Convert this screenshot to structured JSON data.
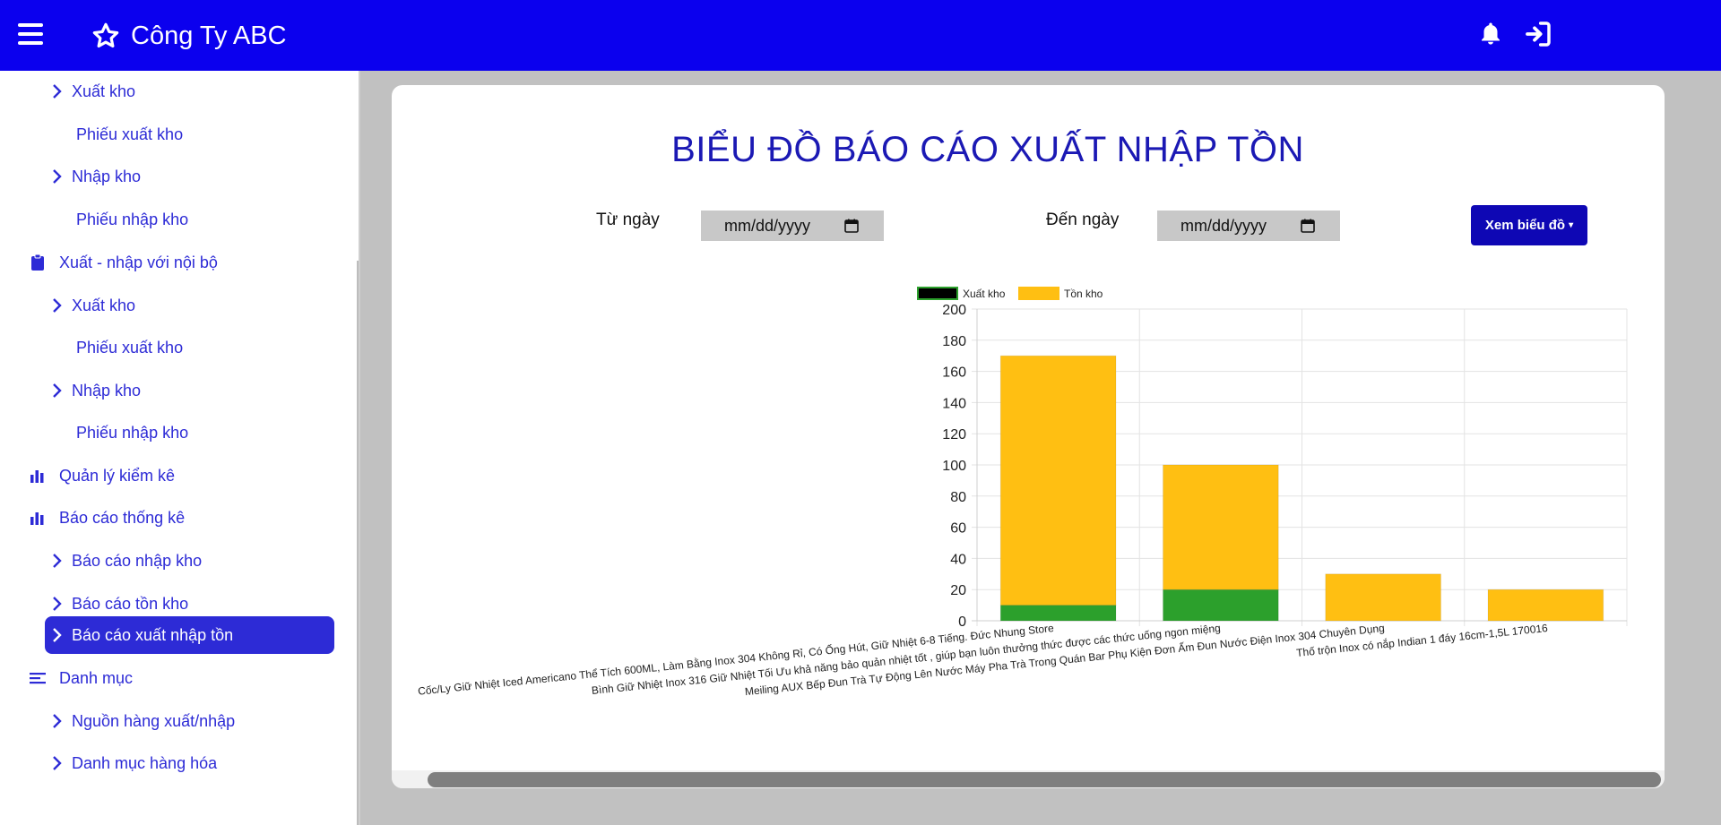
{
  "app": {
    "brand_name": "Công Ty ABC"
  },
  "sidebar": {
    "items": [
      {
        "label": "Xuất kho"
      },
      {
        "label": "Phiếu xuất kho"
      },
      {
        "label": "Nhập kho"
      },
      {
        "label": "Phiếu nhập kho"
      },
      {
        "label": "Xuất - nhập với nội bộ"
      },
      {
        "label": "Xuất kho"
      },
      {
        "label": "Phiếu xuất kho"
      },
      {
        "label": "Nhập kho"
      },
      {
        "label": "Phiếu nhập kho"
      },
      {
        "label": "Quản lý kiểm kê"
      },
      {
        "label": "Báo cáo thống kê"
      },
      {
        "label": "Báo cáo nhập kho"
      },
      {
        "label": "Báo cáo tồn kho"
      },
      {
        "label": "Báo cáo xuất nhập tồn"
      },
      {
        "label": "Danh mục"
      },
      {
        "label": "Nguồn hàng xuất/nhập"
      },
      {
        "label": "Danh mục hàng hóa"
      }
    ]
  },
  "main": {
    "title": "BIỂU ĐỒ BÁO CÁO XUẤT NHẬP TỒN",
    "from_label": "Từ ngày",
    "to_label": "Đến ngày",
    "from_value": "mm/dd/yyyy",
    "to_value": "mm/dd/yyyy",
    "view_button": "Xem biểu đồ"
  },
  "colors": {
    "topbar": "#0b00ee",
    "accent": "#2d2bd6",
    "xuat_kho": "#2ca02c",
    "ton_kho": "#ffbf12"
  },
  "chart_data": {
    "type": "bar",
    "stacked": true,
    "categories": [
      "Cốc/Ly Giữ Nhiệt Iced Americano Thể Tích 600ML, Làm Bằng Inox 304 Không Rỉ, Có Ống Hút, Giữ Nhiệt 6-8 Tiếng. Đức Nhung Store",
      "Bình Giữ Nhiệt Inox 316 Giữ Nhiệt Tối Ưu khả năng bảo quản nhiệt tốt , giúp bạn luôn thưởng thức được các thức uống ngon miệng",
      "Meiling AUX Bếp Đun Trà Tự Động Lên Nước Máy Pha Trà Trong Quán Bar Phụ Kiện Đơn Ấm Đun Nước Điện Inox 304 Chuyên Dụng",
      "Thố trộn Inox có nắp Indian 1 đáy 16cm-1,5L 170016"
    ],
    "series": [
      {
        "name": "Xuất kho",
        "values": [
          10,
          20,
          0,
          0
        ]
      },
      {
        "name": "Tồn kho",
        "values": [
          160,
          80,
          30,
          20
        ]
      }
    ],
    "yticks": [
      "0",
      "20",
      "40",
      "60",
      "80",
      "100",
      "120",
      "140",
      "160",
      "180",
      "200"
    ],
    "ylim": [
      0,
      200
    ],
    "grid": true,
    "legend_position": "top"
  }
}
